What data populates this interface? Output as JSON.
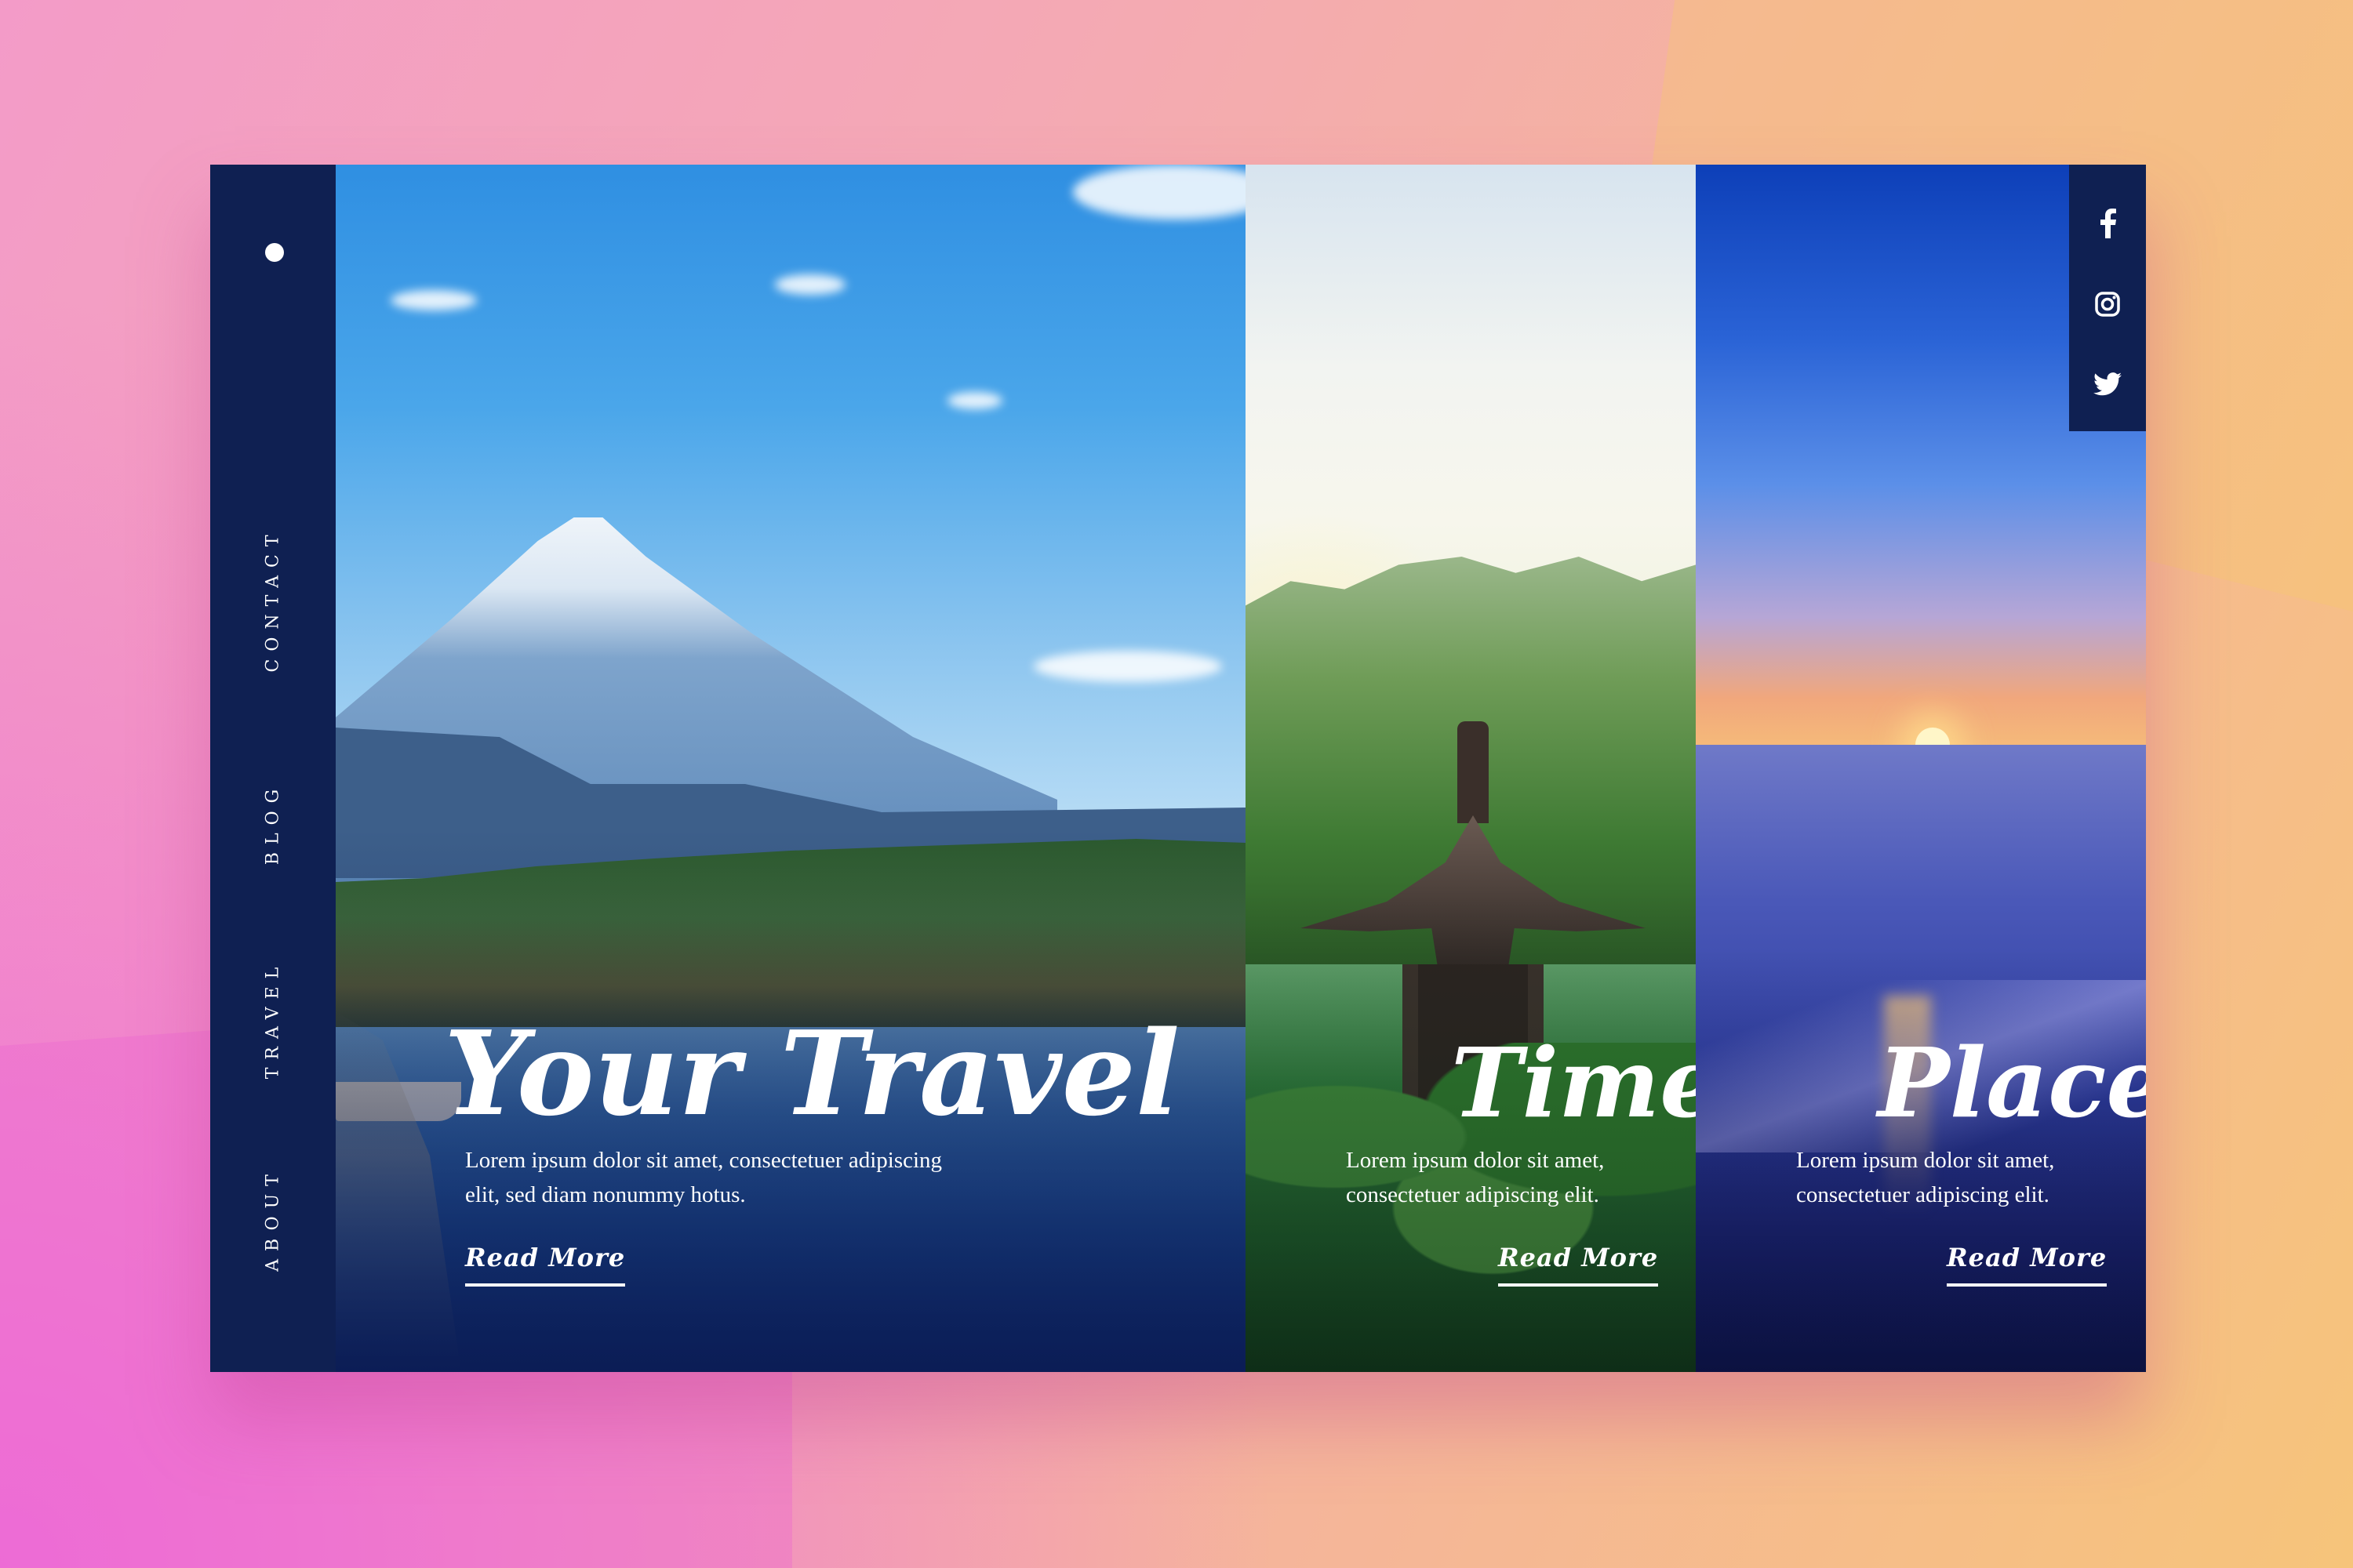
{
  "nav": {
    "items": [
      {
        "label": "ABOUT"
      },
      {
        "label": "TRAVEL"
      },
      {
        "label": "BLOG"
      },
      {
        "label": "CONTACT"
      }
    ]
  },
  "social": {
    "icons": [
      "facebook-icon",
      "instagram-icon",
      "twitter-icon"
    ]
  },
  "panels": [
    {
      "title": "Your Travel",
      "description_line1": "Lorem ipsum dolor sit amet, consectetuer adipiscing",
      "description_line2": "elit, sed diam nonummy hotus.",
      "cta": "Read More"
    },
    {
      "title": "Time",
      "description_line1": "Lorem ipsum dolor sit amet,",
      "description_line2": "consectetuer adipiscing elit.",
      "cta": "Read More"
    },
    {
      "title": "Place",
      "description_line1": "Lorem ipsum dolor sit amet,",
      "description_line2": "consectetuer adipiscing elit.",
      "cta": "Read More"
    }
  ],
  "colors": {
    "navy": "#0f2052",
    "text": "#ffffff"
  }
}
